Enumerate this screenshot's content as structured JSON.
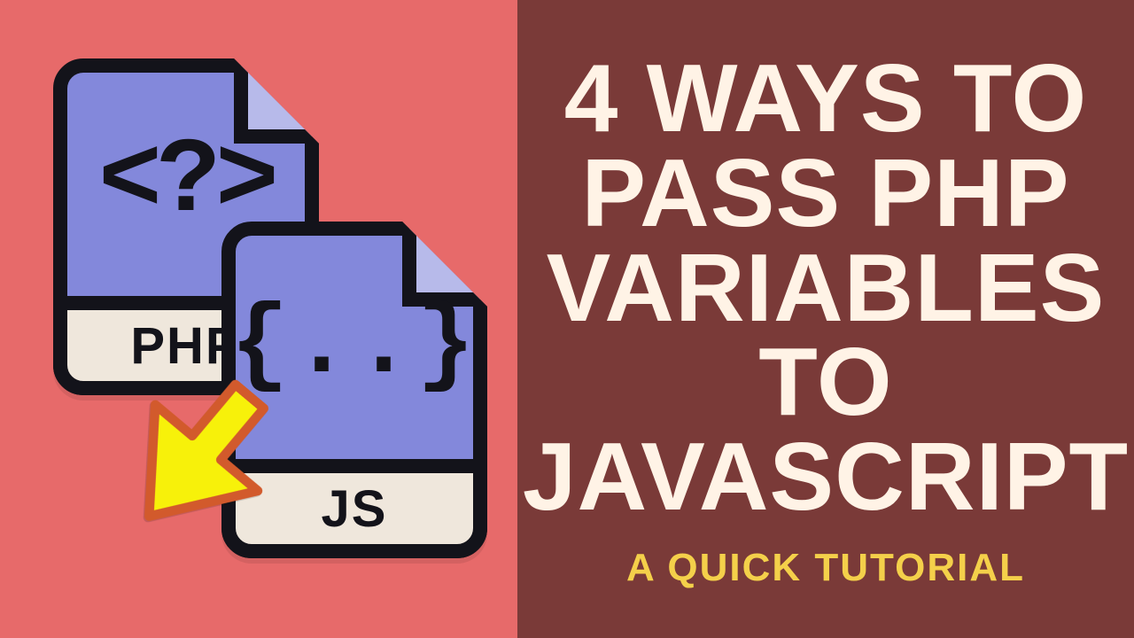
{
  "colors": {
    "left_bg": "#e76a6a",
    "right_bg": "#7a3a38",
    "headline": "#fff3e6",
    "subtitle": "#f4d04a",
    "file_body": "#8388db",
    "file_fold": "#b7baea",
    "file_label_bg": "#efe7dc",
    "outline": "#13131a",
    "arrow_fill": "#f7f10a",
    "arrow_stroke": "#d25a2c"
  },
  "headline": {
    "l1": "4 WAYS TO",
    "l2": "PASS PHP",
    "l3": "VARIABLES TO",
    "l4": "JAVASCRIPT"
  },
  "subtitle": "A QUICK TUTORIAL",
  "files": {
    "php": {
      "label": "PHP",
      "glyph": "<?>"
    },
    "js": {
      "label": "JS",
      "glyph": "{..}"
    }
  }
}
